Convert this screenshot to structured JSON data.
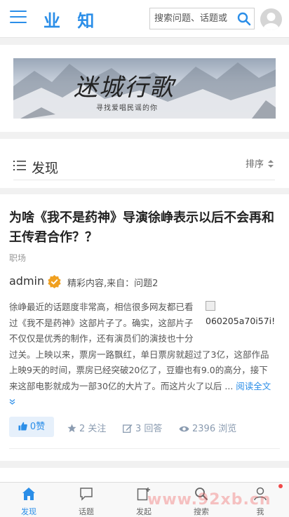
{
  "header": {
    "logo": "业 知",
    "search_placeholder": "搜索问题、话题或",
    "icons": [
      "menu-icon",
      "search-icon",
      "avatar"
    ]
  },
  "banner": {
    "title": "迷城行歌",
    "subtitle": "寻找爱唱民谣的你"
  },
  "section": {
    "title": "发现",
    "sort_label": "排序"
  },
  "article": {
    "title": "为啥《我不是药神》导演徐峥表示以后不会再和王传君合作？？",
    "category": "职场",
    "author": "admin",
    "meta": "精彩内容,来自：问题2",
    "image_alt": "060205a70i57i!",
    "body": "徐峥最近的话题度非常高，相信很多网友都已看过《我不是药神》这部片子了。确实，这部片子不仅仅是优秀的制作，还有演员们的演技也十分过关。上映以来，票房一路飘红，单日票房就超过了3亿，这部作品上映9天的时间，票房已经突破20亿了，豆瓣也有9.0的高分，接下来这部电影就成为一部30亿的大片了。而这片火了以后 ...",
    "read_more": "阅读全文",
    "likes": "0赞",
    "follows": "2 关注",
    "answers": "3 回答",
    "views": "2396 浏览"
  },
  "bottom_nav": [
    {
      "label": "发现",
      "icon": "home-icon",
      "active": true
    },
    {
      "label": "话题",
      "icon": "chat-icon",
      "active": false
    },
    {
      "label": "发起",
      "icon": "compose-icon",
      "active": false
    },
    {
      "label": "搜索",
      "icon": "search-icon",
      "active": false
    },
    {
      "label": "我",
      "icon": "user-icon",
      "active": false
    }
  ],
  "watermark": "www.92xb.cn",
  "colors": {
    "accent": "#2b8ee8",
    "badge": "#f0a020",
    "notification": "#f04848"
  }
}
